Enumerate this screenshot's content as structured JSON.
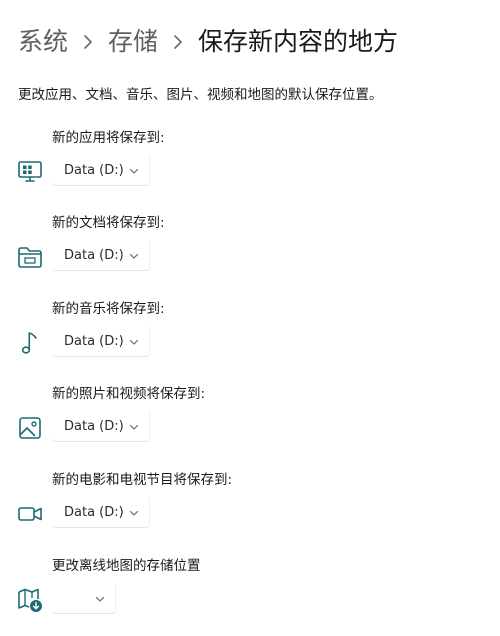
{
  "breadcrumb": {
    "items": [
      "系统",
      "存储"
    ],
    "current": "保存新内容的地方"
  },
  "description": "更改应用、文档、音乐、图片、视频和地图的默认保存位置。",
  "colors": {
    "accent": "#1c6b73",
    "text": "#1a1a1a",
    "muted": "#5f5f5f"
  },
  "settings": [
    {
      "label": "新的应用将保存到:",
      "value": "Data (D:)",
      "icon": "apps-icon"
    },
    {
      "label": "新的文档将保存到:",
      "value": "Data (D:)",
      "icon": "folder-icon"
    },
    {
      "label": "新的音乐将保存到:",
      "value": "Data (D:)",
      "icon": "music-note-icon"
    },
    {
      "label": "新的照片和视频将保存到:",
      "value": "Data (D:)",
      "icon": "image-icon"
    },
    {
      "label": "新的电影和电视节目将保存到:",
      "value": "Data (D:)",
      "icon": "video-camera-icon"
    },
    {
      "label": "更改离线地图的存储位置",
      "value": "",
      "icon": "map-download-icon"
    }
  ]
}
